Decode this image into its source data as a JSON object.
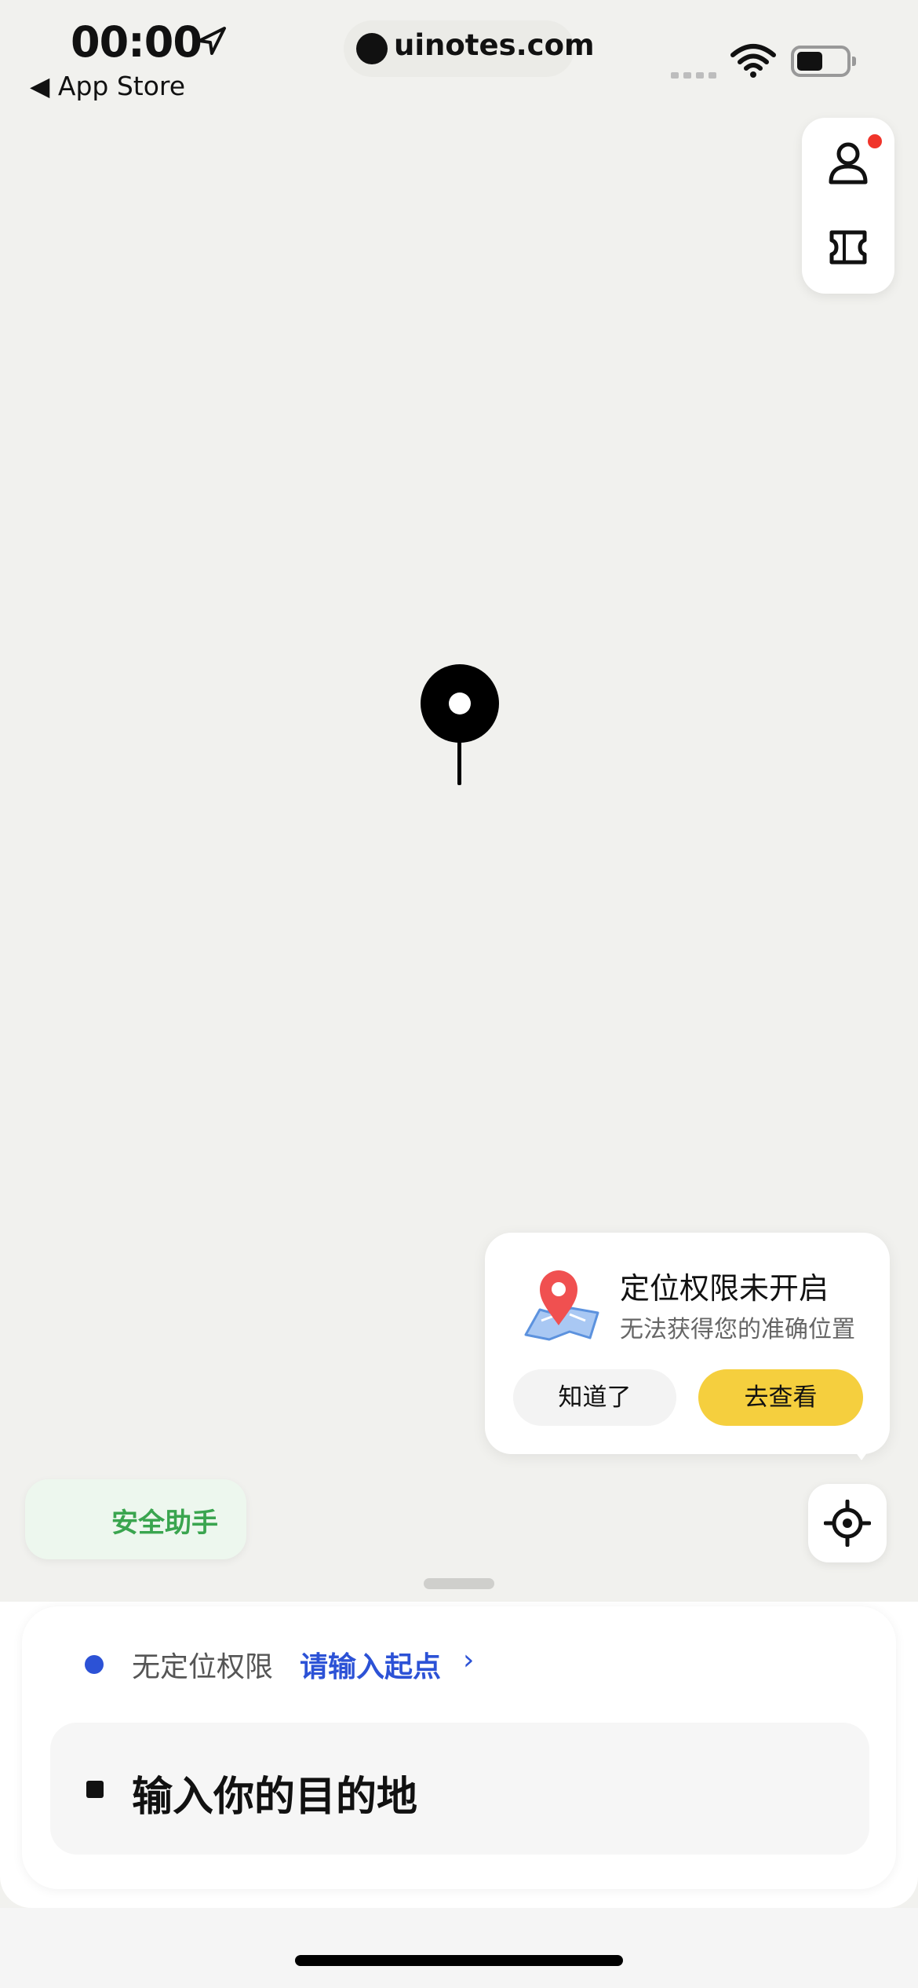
{
  "status_bar": {
    "time": "00:00",
    "back_label": "◀ App Store",
    "url": "uinotes.com"
  },
  "side_card": {
    "profile_icon": "person-icon",
    "ticket_icon": "ticket-icon",
    "notification_color": "#f0342a"
  },
  "map": {
    "pin_icon": "map-pin-icon"
  },
  "permission_popup": {
    "icon": "map-location-icon",
    "title": "定位权限未开启",
    "subtitle": "无法获得您的准确位置",
    "dismiss_label": "知道了",
    "view_label": "去查看",
    "view_color": "#f5cf3e"
  },
  "safety_helper": {
    "label": "安全助手",
    "color": "#3aa54f"
  },
  "locate_button": {
    "icon": "locate-crosshair-icon"
  },
  "trip": {
    "start_prefix": "无定位权限",
    "start_action": "请输入起点",
    "start_chevron": "›",
    "start_color": "#2c52d6",
    "destination_placeholder": "输入你的目的地"
  }
}
